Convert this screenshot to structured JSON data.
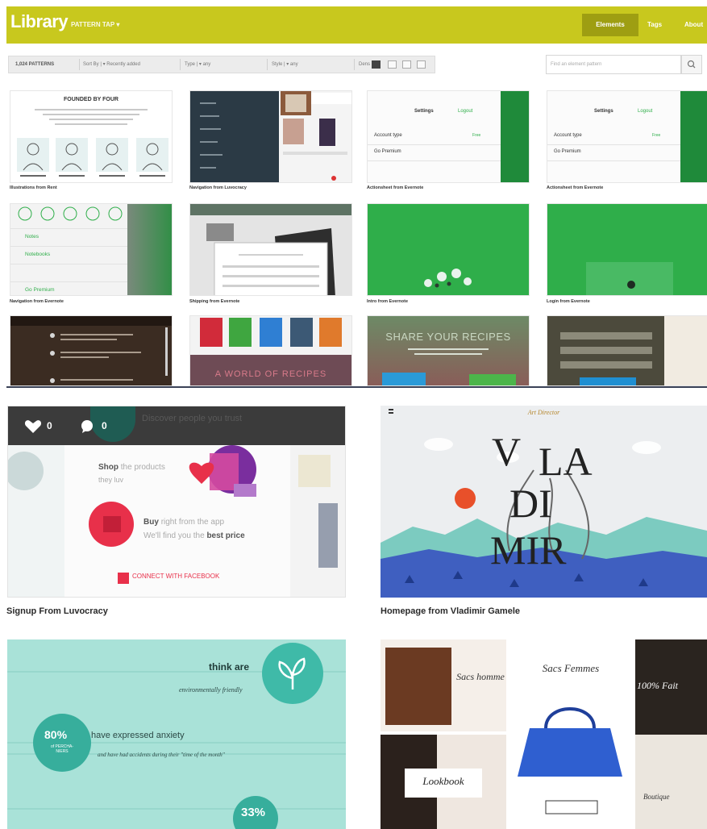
{
  "header": {
    "brand": "Library",
    "subtitle": "PATTERN TAP",
    "nav": {
      "elements": "Elements",
      "tags": "Tags",
      "about": "About"
    }
  },
  "toolbar": {
    "count": "1,024 PATTERNS",
    "sort_by": "Sort By",
    "sort_value": "Recently added",
    "type_label": "Type",
    "type_value": "any",
    "style_label": "Style",
    "style_value": "any",
    "density_label": "Dens"
  },
  "search": {
    "placeholder": "Find an element pattern"
  },
  "thumbs": {
    "t1": {
      "title": "FOUNDED BY FOUR",
      "caption": "Illustrations from Rent"
    },
    "t2": {
      "caption": "Navigation from Luvocracy"
    },
    "t3": {
      "caption": "Actionsheet from Evernote",
      "bar_title": "Settings",
      "logout": "Logout",
      "account_type": "Account type",
      "account_value": "Free",
      "premium": "Go Premium"
    },
    "t4": {
      "caption": "Actionsheet from Evernote",
      "bar_title": "Settings",
      "logout": "Logout",
      "account_type": "Account type",
      "account_value": "Free",
      "premium": "Go Premium"
    },
    "t5": {
      "caption": "Navigation from Evernote",
      "notes": "Notes",
      "notebooks": "Notebooks",
      "premium": "Go Premium"
    },
    "t6": {
      "caption": "Shipping from Evernote"
    },
    "t7": {
      "caption": "Intro from Evernote"
    },
    "t8": {
      "caption": "Login from Evernote"
    },
    "t11": {
      "headline": "SHARE YOUR RECIPES"
    },
    "t10": {
      "headline": "A WORLD OF RECIPES"
    }
  },
  "cards": {
    "signup": {
      "caption": "Signup From Luvocracy",
      "likes": "0",
      "comments": "0",
      "banner": "Discover people you trust",
      "shop_strong": "Shop",
      "shop_rest": "the products",
      "shop_line2": "they luv",
      "buy_strong": "Buy",
      "buy_rest": "right from the app",
      "buy_line2a": "We'll find you the",
      "buy_line2b": "best price",
      "facebook": "CONNECT WITH FACEBOOK"
    },
    "vladimir": {
      "caption": "Homepage from Vladimir Gamele",
      "script": "Art Director",
      "letters": [
        "V",
        "LA",
        "DI",
        "MIR"
      ]
    },
    "stats": {
      "line1": "think are",
      "line2": "environmentally friendly",
      "pct1": "80%",
      "line3": "have expressed anxiety",
      "pct1_sub": "of PERCHA-NIERS",
      "line4": "and have had accidents during their \"time of the month\"",
      "pct2": "33%"
    },
    "fashion": {
      "sacs": "Sacs Femmes",
      "sacs_short": "Sacs homme",
      "lookbook": "Lookbook",
      "percent": "100% Fait",
      "boutique": "Boutique"
    }
  },
  "colors": {
    "accent": "#c8c81e",
    "evernote_green": "#2fae4a",
    "luvocracy_red": "#e8304a",
    "teal": "#7fd6c8"
  }
}
